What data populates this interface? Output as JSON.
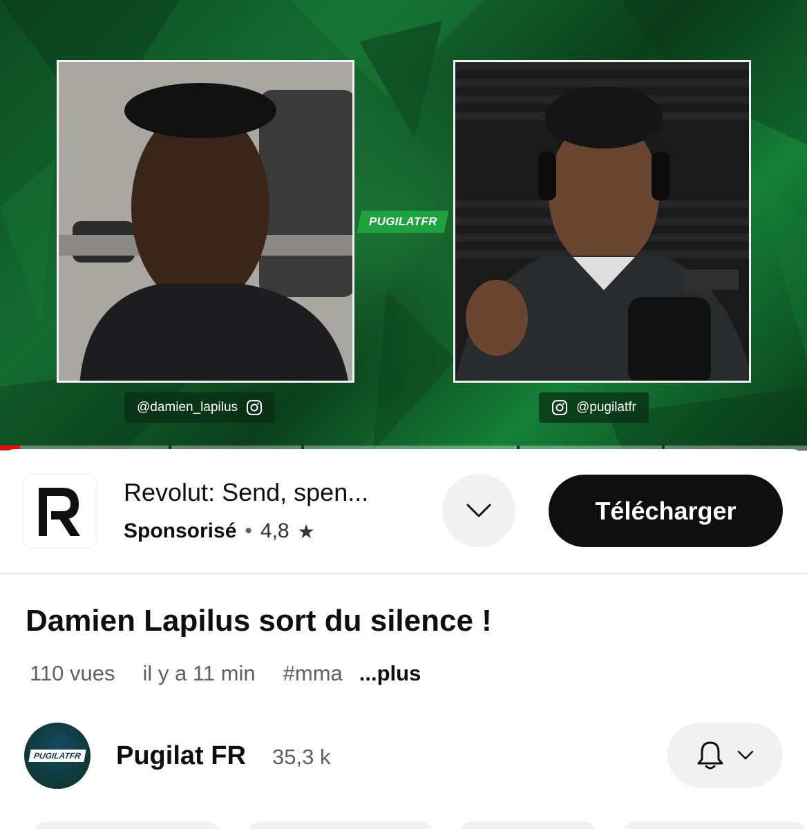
{
  "video": {
    "left_handle": "@damien_lapilus",
    "right_handle": "@pugilatfr",
    "logo_text": "PUGILATFR",
    "progress": 0.025
  },
  "ad": {
    "title": "Revolut: Send, spen...",
    "sponsored_label": "Sponsorisé",
    "separator": "•",
    "rating": "4,8",
    "download_label": "Télécharger"
  },
  "video_info": {
    "title": "Damien Lapilus sort du silence !",
    "views": "110 vues",
    "time_ago": "il y a 11 min",
    "hashtag": "#mma",
    "more_label": "...plus"
  },
  "channel": {
    "name": "Pugilat FR",
    "subscribers": "35,3 k",
    "avatar_text": "PUGILATFR"
  },
  "colors": {
    "progress_red": "#ff0000",
    "brand_green": "#1fa33f",
    "button_dark": "#0f0f0f",
    "chip_grey": "#f1f1f1"
  },
  "icons": {
    "instagram": "instagram-icon",
    "chevron": "chevron-down-icon",
    "star": "star-icon",
    "bell": "bell-icon",
    "revolut": "revolut-logo"
  }
}
